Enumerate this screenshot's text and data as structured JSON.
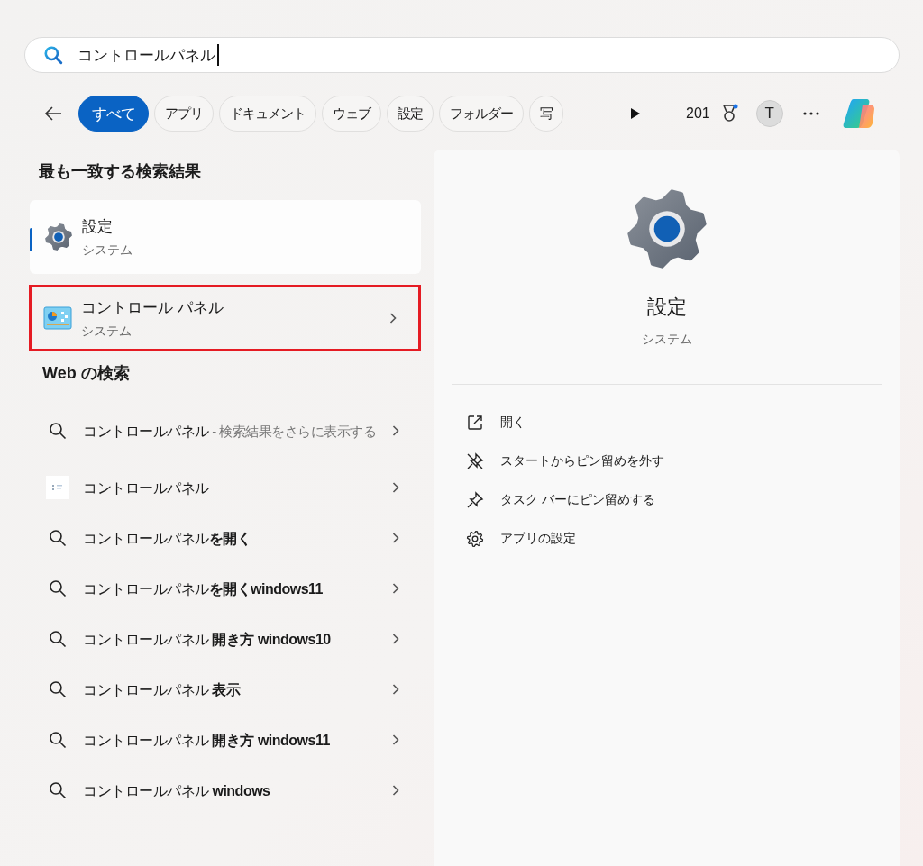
{
  "search": {
    "value": "コントロールパネル"
  },
  "filters": [
    {
      "label": "すべて",
      "selected": true
    },
    {
      "label": "アプリ",
      "selected": false
    },
    {
      "label": "ドキュメント",
      "selected": false
    },
    {
      "label": "ウェブ",
      "selected": false
    },
    {
      "label": "設定",
      "selected": false
    },
    {
      "label": "フォルダー",
      "selected": false
    },
    {
      "label": "写",
      "selected": false
    }
  ],
  "toolbar": {
    "points": "201",
    "avatar": "T"
  },
  "best_match": {
    "heading": "最も一致する検索結果",
    "items": [
      {
        "kind": "settings",
        "title": "設定",
        "subtitle": "システム",
        "selected": true,
        "highlighted": false
      },
      {
        "kind": "control-panel",
        "title": "コントロール パネル",
        "subtitle": "システム",
        "selected": false,
        "highlighted": true
      }
    ]
  },
  "web": {
    "heading": "Web の検索",
    "items": [
      {
        "kind": "search",
        "title": "コントロールパネル",
        "suffix": " - 検索結果をさらに表示する"
      },
      {
        "kind": "thumbnail",
        "title": "コントロールパネル"
      },
      {
        "kind": "search",
        "title": "コントロールパネル**を開く**"
      },
      {
        "kind": "search",
        "title": "コントロールパネル**を開くwindows11**"
      },
      {
        "kind": "search",
        "title": "コントロールパネル **開き方 windows10**"
      },
      {
        "kind": "search",
        "title": "コントロールパネル **表示**"
      },
      {
        "kind": "search",
        "title": "コントロールパネル **開き方 windows11**"
      },
      {
        "kind": "search",
        "title": "コントロールパネル **windows**"
      }
    ]
  },
  "preview": {
    "title": "設定",
    "subtitle": "システム",
    "actions": [
      {
        "kind": "open",
        "label": "開く"
      },
      {
        "kind": "unpin",
        "label": "スタートからピン留めを外す"
      },
      {
        "kind": "pin",
        "label": "タスク バーにピン留めする"
      },
      {
        "kind": "settings",
        "label": "アプリの設定"
      }
    ]
  }
}
